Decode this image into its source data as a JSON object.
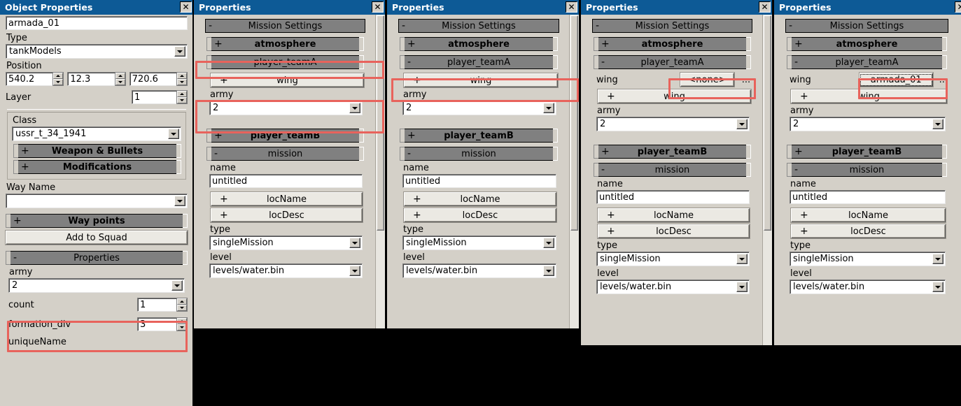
{
  "panels": [
    {
      "title": "Object Properties",
      "close_glyph": "✕",
      "name_value": "armada_01",
      "type_label": "Type",
      "type_value": "tankModels",
      "position_label": "Position",
      "position": [
        "540.2",
        "12.3",
        "720.6"
      ],
      "layer_label": "Layer",
      "layer_value": "1",
      "class_group_label": "Class",
      "class_label": "Class",
      "class_value": "ussr_t_34_1941",
      "weapon_button": "Weapon & Bullets",
      "weapon_pm": "+",
      "modifications_button": "Modifications",
      "modifications_pm": "+",
      "way_name_label": "Way Name",
      "way_name_value": "",
      "way_points_button": "Way points",
      "way_points_pm": "+",
      "add_to_squad_button": "Add to Squad",
      "properties_section": "Properties",
      "properties_pm": "-",
      "army_label": "army",
      "army_value": "2",
      "count_label": "count",
      "count_value": "1",
      "formation_div_label": "formation_div",
      "formation_div_value": "3",
      "unique_name_label": "uniqueName"
    },
    {
      "title": "Properties",
      "close_glyph": "✕",
      "mission_settings": "Mission Settings",
      "mission_settings_pm": "-",
      "atmosphere": "atmosphere",
      "atmosphere_pm": "+",
      "player_teamA": "player_teamA",
      "player_teamA_pm": "-",
      "wing_button": "wing",
      "wing_button_pm": "+",
      "army_label": "army",
      "army_value": "2",
      "player_teamB": "player_teamB",
      "player_teamB_pm": "+",
      "mission": "mission",
      "mission_pm": "-",
      "name_label": "name",
      "name_value": "untitled",
      "locName": "locName",
      "locName_pm": "+",
      "locDesc": "locDesc",
      "locDesc_pm": "+",
      "type_label": "type",
      "type_value": "singleMission",
      "level_label": "level",
      "level_value": "levels/water.bin",
      "has_wing_field": false
    },
    {
      "title": "Properties",
      "close_glyph": "✕",
      "mission_settings": "Mission Settings",
      "mission_settings_pm": "-",
      "atmosphere": "atmosphere",
      "atmosphere_pm": "+",
      "player_teamA": "player_teamA",
      "player_teamA_pm": "-",
      "wing_button": "wing",
      "wing_button_pm": "+",
      "army_label": "army",
      "army_value": "2",
      "player_teamB": "player_teamB",
      "player_teamB_pm": "+",
      "mission": "mission",
      "mission_pm": "-",
      "name_label": "name",
      "name_value": "untitled",
      "locName": "locName",
      "locName_pm": "+",
      "locDesc": "locDesc",
      "locDesc_pm": "+",
      "type_label": "type",
      "type_value": "singleMission",
      "level_label": "level",
      "level_value": "levels/water.bin",
      "has_wing_field": false
    },
    {
      "title": "Properties",
      "close_glyph": "✕",
      "mission_settings": "Mission Settings",
      "mission_settings_pm": "-",
      "atmosphere": "atmosphere",
      "atmosphere_pm": "+",
      "player_teamA": "player_teamA",
      "player_teamA_pm": "-",
      "wing_field_label": "wing",
      "wing_field_value": "<none>",
      "wing_browse": "...",
      "wing_button": "wing",
      "wing_button_pm": "+",
      "army_label": "army",
      "army_value": "2",
      "player_teamB": "player_teamB",
      "player_teamB_pm": "+",
      "mission": "mission",
      "mission_pm": "-",
      "name_label": "name",
      "name_value": "untitled",
      "locName": "locName",
      "locName_pm": "+",
      "locDesc": "locDesc",
      "locDesc_pm": "+",
      "type_label": "type",
      "type_value": "singleMission",
      "level_label": "level",
      "level_value": "levels/water.bin",
      "has_wing_field": true
    },
    {
      "title": "Properties",
      "close_glyph": "✕",
      "mission_settings": "Mission Settings",
      "mission_settings_pm": "-",
      "atmosphere": "atmosphere",
      "atmosphere_pm": "+",
      "player_teamA": "player_teamA",
      "player_teamA_pm": "-",
      "wing_field_label": "wing",
      "wing_field_value": "armada_01",
      "wing_browse": "...",
      "wing_button": "wing",
      "wing_button_pm": "+",
      "army_label": "army",
      "army_value": "2",
      "player_teamB": "player_teamB",
      "player_teamB_pm": "+",
      "mission": "mission",
      "mission_pm": "-",
      "name_label": "name",
      "name_value": "untitled",
      "locName": "locName",
      "locName_pm": "+",
      "locDesc": "locDesc",
      "locDesc_pm": "+",
      "type_label": "type",
      "type_value": "singleMission",
      "level_label": "level",
      "level_value": "levels/water.bin",
      "has_wing_field": true
    }
  ],
  "annotation": {
    "color": "#e8635c"
  }
}
